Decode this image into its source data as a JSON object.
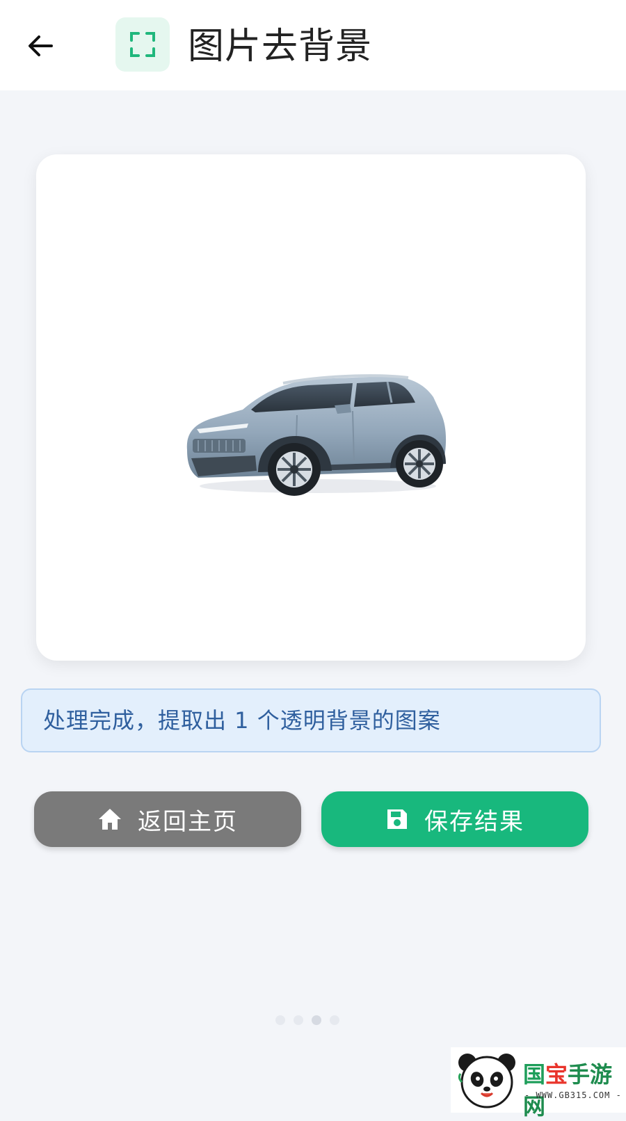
{
  "header": {
    "back_icon": "arrow-left-icon",
    "title_icon": "crop-frame-icon",
    "title": "图片去背景"
  },
  "preview": {
    "image_subject": "car-image"
  },
  "status": {
    "message": "处理完成，提取出 1 个透明背景的图案"
  },
  "actions": {
    "home_icon": "home-icon",
    "home_label": "返回主页",
    "save_icon": "save-icon",
    "save_label": "保存结果"
  },
  "pager": {
    "count": 4,
    "active_index": 2
  },
  "watermark": {
    "brand_part1": "国",
    "brand_part2": "宝",
    "brand_part3": "手游网",
    "url": "- WWW.GB315.COM -"
  },
  "colors": {
    "accent": "#18b87d",
    "home_button": "#7a7a7a",
    "status_bg": "#e3effc",
    "status_text": "#2f5f9e",
    "page_bg": "#f3f5f9"
  }
}
